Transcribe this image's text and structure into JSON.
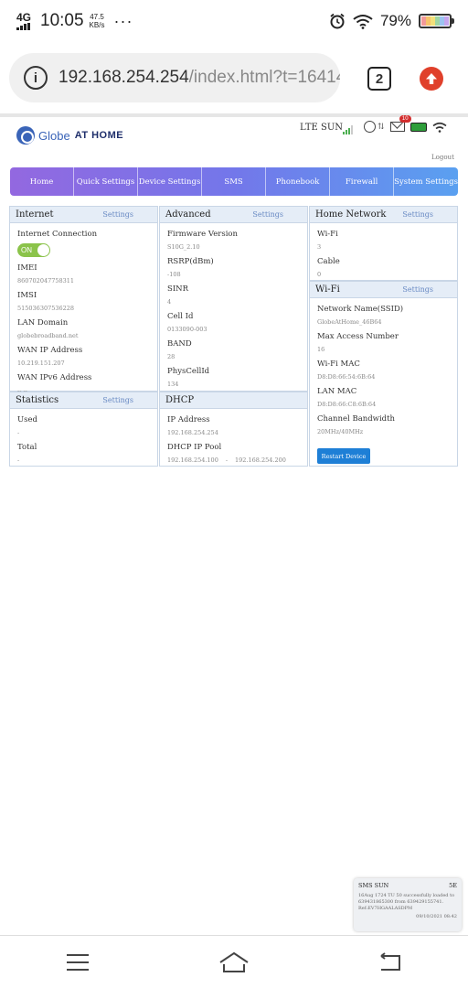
{
  "status_bar": {
    "network": "4G",
    "time": "10:05",
    "speed_value": "47.5",
    "speed_unit": "KB/s",
    "more": "···",
    "battery_pct": "79%"
  },
  "browser": {
    "url_host": "192.168.254.254",
    "url_path": "/index.html?t=164140",
    "tab_count": "2"
  },
  "router_header": {
    "brand_globe": "Globe",
    "brand_at_home": "AT HOME",
    "carrier": "LTE SUN",
    "mail_badge": "10",
    "logout": "Logout"
  },
  "nav": [
    "Home",
    "Quick Settings",
    "Device Settings",
    "SMS",
    "Phonebook",
    "Firewall",
    "System Settings"
  ],
  "internet": {
    "title": "Internet",
    "settings": "Settings",
    "connection_label": "Internet Connection",
    "toggle_label": "ON",
    "imei_label": "IMEI",
    "imei_value": "860702047758311",
    "imsi_label": "IMSI",
    "imsi_value": "515036307536228",
    "lan_domain_label": "LAN Domain",
    "lan_domain_value": "globebroadband.net",
    "wan_ip_label": "WAN IP Address",
    "wan_ip_value": "10.219.151.207",
    "wan_ipv6_label": "WAN IPv6 Address",
    "wan_ipv6_value": "-- --"
  },
  "statistics": {
    "title": "Statistics",
    "settings": "Settings",
    "used_label": "Used",
    "used_value": "-",
    "total_label": "Total",
    "total_value": "-"
  },
  "advanced": {
    "title": "Advanced",
    "settings": "Settings",
    "firmware_label": "Firmware Version",
    "firmware_value": "S10G_2.10",
    "rsrp_label": "RSRP(dBm)",
    "rsrp_value": "-108",
    "sinr_label": "SINR",
    "sinr_value": "4",
    "cell_id_label": "Cell Id",
    "cell_id_value": "0133090-003",
    "band_label": "BAND",
    "band_value": "28",
    "phys_cell_label": "PhysCellId",
    "phys_cell_value": "134"
  },
  "dhcp": {
    "title": "DHCP",
    "ip_label": "IP Address",
    "ip_value": "192.168.254.254",
    "pool_label": "DHCP IP Pool",
    "pool_start": "192.168.254.100",
    "pool_sep": "-",
    "pool_end": "192.168.254.200"
  },
  "home_network": {
    "title": "Home Network",
    "settings": "Settings",
    "wifi_label": "Wi-Fi",
    "wifi_value": "3",
    "cable_label": "Cable",
    "cable_value": "0"
  },
  "wifi": {
    "title": "Wi-Fi",
    "settings": "Settings",
    "ssid_label": "Network Name(SSID)",
    "ssid_value": "GlobeAtHome_46B64",
    "max_access_label": "Max Access Number",
    "max_access_value": "16",
    "wifi_mac_label": "Wi-Fi MAC",
    "wifi_mac_value": "D8:D8:66:54:6B:64",
    "lan_mac_label": "LAN MAC",
    "lan_mac_value": "D8:D8:66:C8:6B:64",
    "bandwidth_label": "Channel Bandwidth",
    "bandwidth_value": "20MHz/40MHz",
    "restart_button": "Restart Device"
  },
  "sms_toast": {
    "sender": "SMS SUN",
    "close": "5E",
    "body": "16Aug 1724 TU 50 successfully loaded to 639431865300 from 639429155741. Ref:EV7HGAALASDPM",
    "date": "09/10/2021 08:42"
  },
  "colors": {
    "nav_gradient_start": "#9368e0",
    "nav_gradient_end": "#5aa0f0",
    "panel_header": "#e5edf7",
    "restart_button": "#1e7fd6",
    "toggle_on": "#8bc34a",
    "upload_button": "#e0402b"
  }
}
